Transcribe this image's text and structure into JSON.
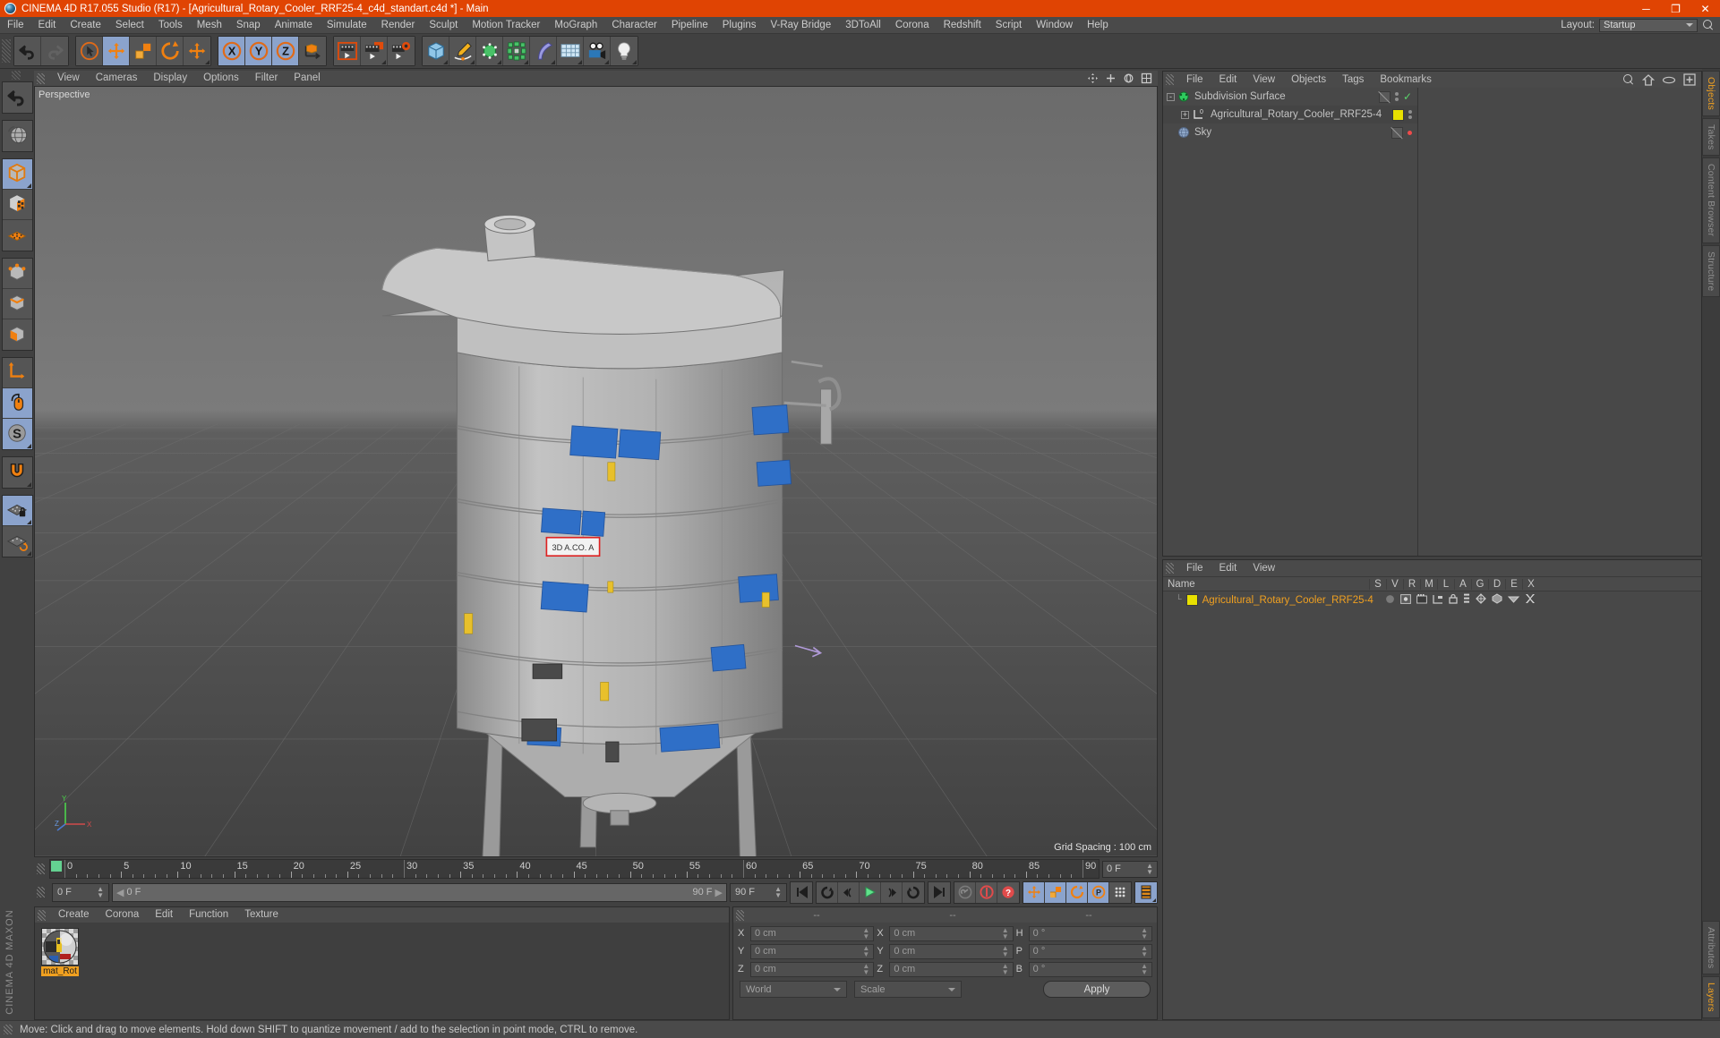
{
  "window": {
    "title": "CINEMA 4D R17.055 Studio (R17) - [Agricultural_Rotary_Cooler_RRF25-4_c4d_standart.c4d *] - Main",
    "minimize": "─",
    "maximize": "❐",
    "close": "✕"
  },
  "menubar": {
    "items": [
      "File",
      "Edit",
      "Create",
      "Select",
      "Tools",
      "Mesh",
      "Snap",
      "Animate",
      "Simulate",
      "Render",
      "Sculpt",
      "Motion Tracker",
      "MoGraph",
      "Character",
      "Pipeline",
      "Plugins",
      "V-Ray Bridge",
      "3DToAll",
      "Corona",
      "Redshift",
      "Script",
      "Window",
      "Help"
    ],
    "layout_label": "Layout:",
    "layout_value": "Startup",
    "search_icon": "search-icon"
  },
  "toolbar": {
    "groups": [
      {
        "name": "undo-redo",
        "buttons": [
          {
            "name": "undo-button",
            "icon": "undo-icon",
            "active": false
          },
          {
            "name": "redo-button",
            "icon": "redo-icon",
            "active": false,
            "disabled": true
          }
        ]
      },
      {
        "name": "transform-tools",
        "buttons": [
          {
            "name": "live-selection-button",
            "icon": "cursor-circle-icon",
            "active": false
          },
          {
            "name": "move-tool-button",
            "icon": "move-icon",
            "active": true
          },
          {
            "name": "scale-tool-button",
            "icon": "scale-icon",
            "active": false
          },
          {
            "name": "rotate-tool-button",
            "icon": "rotate-icon",
            "active": false
          },
          {
            "name": "move-secondary-button",
            "icon": "move-icon",
            "active": false,
            "corner": true
          }
        ]
      },
      {
        "name": "axis-locks",
        "buttons": [
          {
            "name": "x-axis-lock-button",
            "icon": "x-axis-icon",
            "active": true
          },
          {
            "name": "y-axis-lock-button",
            "icon": "y-axis-icon",
            "active": true
          },
          {
            "name": "z-axis-lock-button",
            "icon": "z-axis-icon",
            "active": true
          },
          {
            "name": "world-object-coord-button",
            "icon": "world-coord-icon",
            "active": false
          }
        ]
      },
      {
        "name": "render-tools",
        "buttons": [
          {
            "name": "render-view-button",
            "icon": "render-view-icon",
            "active": false
          },
          {
            "name": "render-to-picture-viewer-button",
            "icon": "render-picture-icon",
            "active": false,
            "corner": true
          },
          {
            "name": "render-settings-button",
            "icon": "render-settings-icon",
            "active": false
          }
        ]
      },
      {
        "name": "create-objects",
        "buttons": [
          {
            "name": "add-cube-button",
            "icon": "cube-icon",
            "active": false,
            "corner": true
          },
          {
            "name": "add-spline-button",
            "icon": "pen-spline-icon",
            "active": false,
            "corner": true
          },
          {
            "name": "add-generator-button",
            "icon": "generator-icon",
            "active": false,
            "corner": true
          },
          {
            "name": "add-array-button",
            "icon": "array-icon",
            "active": false,
            "corner": true
          },
          {
            "name": "add-deformer-button",
            "icon": "bend-deformer-icon",
            "active": false,
            "corner": true
          },
          {
            "name": "add-environment-button",
            "icon": "floor-environment-icon",
            "active": false,
            "corner": true
          },
          {
            "name": "add-camera-button",
            "icon": "camera-icon",
            "active": false,
            "corner": true
          },
          {
            "name": "add-light-button",
            "icon": "light-bulb-icon",
            "active": false,
            "corner": true
          }
        ]
      }
    ]
  },
  "lefttoolbar": {
    "groups": [
      [
        {
          "name": "undo-view-button",
          "icon": "undo-icon",
          "active": false
        }
      ],
      [
        {
          "name": "render-region-button",
          "icon": "globe-render-icon",
          "active": false
        }
      ],
      [
        {
          "name": "model-mode-button",
          "icon": "model-cube-icon",
          "active": true,
          "corner": true
        },
        {
          "name": "texture-mode-button",
          "icon": "texture-cube-icon",
          "active": false
        },
        {
          "name": "polygon-mode-button",
          "icon": "polygon-grid-icon",
          "active": false
        }
      ],
      [
        {
          "name": "points-mode-button",
          "icon": "points-cube-icon",
          "active": false
        },
        {
          "name": "edges-mode-button",
          "icon": "edges-cube-icon",
          "active": false
        },
        {
          "name": "faces-mode-button",
          "icon": "faces-cube-icon",
          "active": false
        }
      ],
      [
        {
          "name": "object-axis-button",
          "icon": "axis-icon",
          "active": false
        },
        {
          "name": "viewport-navigation-button",
          "icon": "mouse-icon",
          "active": true
        },
        {
          "name": "enable-snapping-button",
          "icon": "snap-s-icon",
          "active": true,
          "corner": true
        }
      ],
      [
        {
          "name": "magnet-tool-button",
          "icon": "magnet-icon",
          "active": false,
          "corner": true
        }
      ],
      [
        {
          "name": "workplane-lock-button",
          "icon": "workplane-lock-icon",
          "active": true,
          "corner": true
        },
        {
          "name": "workplane-rotate-button",
          "icon": "workplane-rotate-icon",
          "active": false,
          "corner": true
        }
      ]
    ],
    "logo_line1": "MAXON",
    "logo_line2": "CINEMA 4D"
  },
  "viewport": {
    "menu": [
      "View",
      "Cameras",
      "Display",
      "Options",
      "Filter",
      "Panel"
    ],
    "label": "Perspective",
    "grid_spacing": "Grid Spacing : 100 cm",
    "axis_x": "X",
    "axis_y": "Y",
    "axis_z": "Z",
    "icons": [
      "pan-view-icon",
      "zoom-view-icon",
      "rotate-view-icon",
      "maximize-view-icon"
    ]
  },
  "timeline": {
    "ticks": [
      0,
      5,
      10,
      15,
      20,
      25,
      30,
      35,
      40,
      45,
      50,
      55,
      60,
      65,
      70,
      75,
      80,
      85,
      90
    ],
    "min_frame": 0,
    "max_frame": 90,
    "current_frame_field": "0 F",
    "start_field": "0 F",
    "range_start": "0 F",
    "range_end": "90 F",
    "end_field": "90 F",
    "transport": [
      {
        "name": "go-to-start-button",
        "icon": "skip-start-icon"
      },
      {
        "name": "play-backwards-button",
        "icon": "rewind-loop-icon"
      },
      {
        "name": "previous-frame-button",
        "icon": "step-back-icon"
      },
      {
        "name": "play-button",
        "icon": "play-icon"
      },
      {
        "name": "next-frame-button",
        "icon": "step-forward-icon"
      },
      {
        "name": "play-forwards-button",
        "icon": "forward-loop-icon"
      },
      {
        "name": "go-to-end-button",
        "icon": "skip-end-icon"
      },
      {
        "name": "record-active-objects-button",
        "icon": "key-icon"
      },
      {
        "name": "autokeying-button",
        "icon": "autokey-icon"
      },
      {
        "name": "keyframe-selection-button",
        "icon": "question-key-icon"
      },
      {
        "name": "position-key-button",
        "icon": "move-icon"
      },
      {
        "name": "scale-key-button",
        "icon": "scale-icon"
      },
      {
        "name": "rotation-key-button",
        "icon": "rotate-icon"
      },
      {
        "name": "parameter-key-button",
        "icon": "param-p-icon"
      },
      {
        "name": "point-level-animation-button",
        "icon": "pla-dots-icon"
      },
      {
        "name": "timeline-filmstrip-button",
        "icon": "filmstrip-icon"
      }
    ]
  },
  "material_manager": {
    "menu": [
      "Create",
      "Corona",
      "Edit",
      "Function",
      "Texture"
    ],
    "materials": [
      {
        "name": "mat_Rot",
        "selected": true
      }
    ]
  },
  "coordinates": {
    "header": [
      "--",
      "--",
      "--"
    ],
    "rows": [
      {
        "label1": "X",
        "value1": "0 cm",
        "label2": "X",
        "value2": "0 cm",
        "label3": "H",
        "value3": "0 °"
      },
      {
        "label1": "Y",
        "value1": "0 cm",
        "label2": "Y",
        "value2": "0 cm",
        "label3": "P",
        "value3": "0 °"
      },
      {
        "label1": "Z",
        "value1": "0 cm",
        "label2": "Z",
        "value2": "0 cm",
        "label3": "B",
        "value3": "0 °"
      }
    ],
    "coord_system": "World",
    "size_mode": "Scale",
    "apply_label": "Apply"
  },
  "object_manager": {
    "menu": [
      "File",
      "Edit",
      "View",
      "Objects",
      "Tags",
      "Bookmarks"
    ],
    "icons": [
      "search-icon",
      "home-icon",
      "eye-icon",
      "add-layer-icon"
    ],
    "rows": [
      {
        "name": "Subdivision Surface",
        "icon": "subdivision-surface-icon",
        "indent": 0,
        "expander": "-",
        "tags": [
          "slash-box",
          "dots",
          "check"
        ]
      },
      {
        "name": "Agricultural_Rotary_Cooler_RRF25-4",
        "icon": "null-object-icon",
        "indent": 1,
        "expander": "+",
        "tags": [
          "yellow-tag",
          "dots"
        ]
      },
      {
        "name": "Sky",
        "icon": "sky-object-icon",
        "indent": 0,
        "expander": "",
        "tags": [
          "slash-box",
          "red-dot"
        ]
      }
    ]
  },
  "layer_manager": {
    "menu": [
      "File",
      "Edit",
      "View"
    ],
    "columns": [
      "S",
      "V",
      "R",
      "M",
      "L",
      "A",
      "G",
      "D",
      "E",
      "X"
    ],
    "name_header": "Name",
    "rows": [
      {
        "name": "Agricultural_Rotary_Cooler_RRF25-4",
        "color": "#f0a020",
        "swatch": "#e8e000"
      }
    ]
  },
  "right_tabs": {
    "top": [
      {
        "label": "Objects",
        "active": true
      },
      {
        "label": "Takes",
        "active": false
      },
      {
        "label": "Content Browser",
        "active": false
      },
      {
        "label": "Structure",
        "active": false
      }
    ],
    "bottom": [
      {
        "label": "Attributes",
        "active": false
      },
      {
        "label": "Layers",
        "active": true
      }
    ]
  },
  "statusbar": {
    "text": "Move: Click and drag to move elements. Hold down SHIFT to quantize movement / add to the selection in point mode, CTRL to remove."
  },
  "colors": {
    "accent_orange": "#e04403",
    "highlight_blue": "#8ba3cc",
    "panel_bg": "#414141",
    "tag_yellow": "#e8e000",
    "material_label": "#f0a020"
  }
}
